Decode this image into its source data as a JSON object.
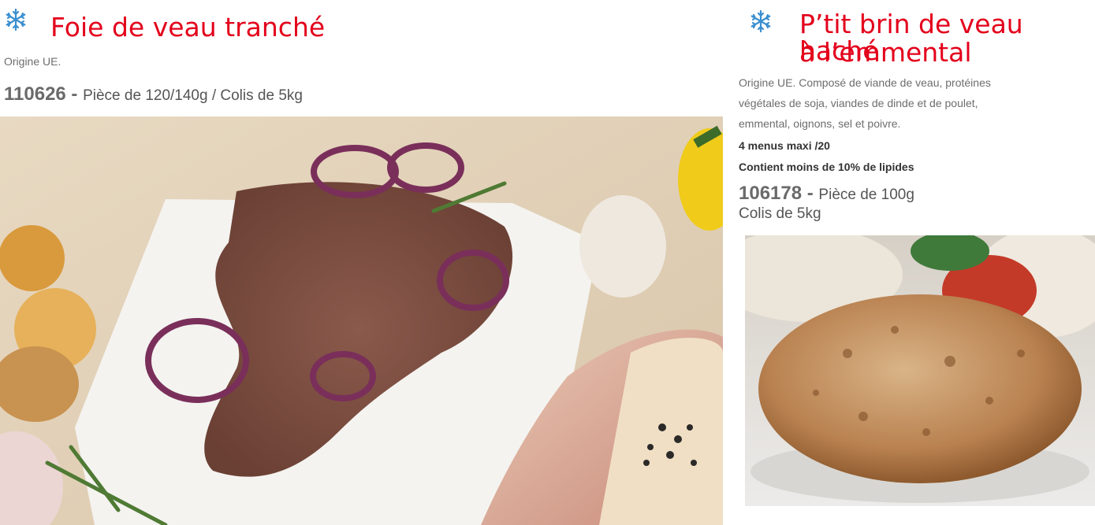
{
  "left": {
    "title": "Foie de veau tranché",
    "origin": "Origine UE.",
    "code": "110626",
    "separator": " - ",
    "description": "Pièce de 120/140g / Colis de 5kg",
    "icon": "snowflake-icon",
    "image": "calf-liver-photo"
  },
  "right": {
    "title_line1": "P’tit brin de veau haché",
    "title_line2": "à l’emmental",
    "origin_line1": "Origine UE. Composé de viande de veau, protéines",
    "origin_line2": "végétales de soja, viandes de dinde et de poulet,",
    "origin_line3": "emmental, oignons, sel et poivre.",
    "note1": "4 menus maxi /20",
    "note2": "Contient moins de 10% de lipides",
    "code": "106178",
    "separator": " - ",
    "description_line1": "Pièce de 100g",
    "description_line2": "Colis de 5kg",
    "icon": "snowflake-icon",
    "image": "veal-patty-photo"
  },
  "colors": {
    "title": "#e3001b",
    "snowflake": "#3a8fd0"
  }
}
